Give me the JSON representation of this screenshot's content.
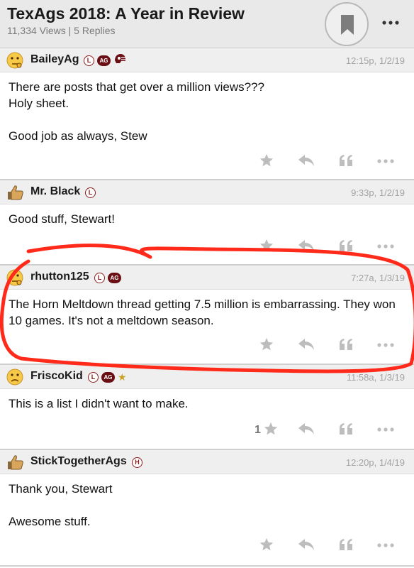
{
  "thread": {
    "title": "TexAgs 2018: A Year in Review",
    "meta": "11,334 Views | 5 Replies"
  },
  "colors": {
    "accent": "#8b1a1a",
    "ag_badge": "#6b0f14",
    "annotation": "#ff2a1a"
  },
  "icons": {
    "bookmark": "bookmark-icon",
    "more": "more-horizontal-icon",
    "favorite": "star-icon",
    "reply": "reply-arrow-icon",
    "quote": "quote-icon"
  },
  "posts": [
    {
      "user": "BaileyAg",
      "avatar": "thinking-face",
      "badges": [
        "L",
        "AG",
        "helmet"
      ],
      "time": "12:15p, 1/2/19",
      "body": "There are posts that get over a million views???\nHoly sheet.\n\nGood job as always, Stew",
      "likes": ""
    },
    {
      "user": "Mr. Black",
      "avatar": "thumbs-up",
      "badges": [
        "L"
      ],
      "time": "9:33p, 1/2/19",
      "body": "Good stuff, Stewart!",
      "likes": ""
    },
    {
      "user": "rhutton125",
      "avatar": "thinking-face",
      "badges": [
        "L",
        "AG"
      ],
      "time": "7:27a, 1/3/19",
      "body": "The Horn Meltdown thread getting 7.5 million is embarrassing. They won 10 games. It's not a meltdown season.",
      "likes": ""
    },
    {
      "user": "FriscoKid",
      "avatar": "frowning-face",
      "badges": [
        "L",
        "AG",
        "star"
      ],
      "time": "11:58a, 1/3/19",
      "body": "This is a list I didn't want to make.",
      "likes": "1"
    },
    {
      "user": "StickTogetherAgs",
      "avatar": "thumbs-up",
      "badges": [
        "H"
      ],
      "time": "12:20p, 1/4/19",
      "body": "Thank you, Stewart\n\nAwesome stuff.",
      "likes": ""
    }
  ]
}
